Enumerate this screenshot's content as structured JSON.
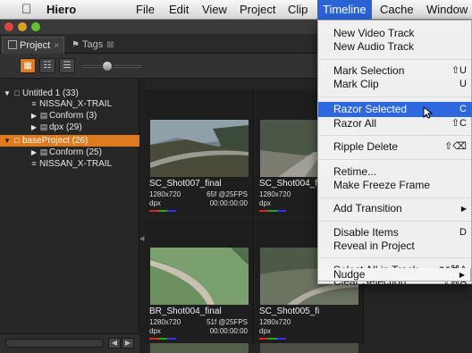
{
  "menubar": {
    "app_name": "Hiero",
    "items": [
      "File",
      "Edit",
      "View",
      "Project",
      "Clip",
      "Timeline",
      "Cache",
      "Window"
    ],
    "active_item": "Timeline"
  },
  "tabs": [
    {
      "label": "Project",
      "close": "×"
    },
    {
      "label": "Tags",
      "close": "⊠"
    }
  ],
  "tree": [
    {
      "label": "Untitled 1 (33)",
      "icon": "project-icon",
      "expanded": true
    },
    {
      "label": "NISSAN_X-TRAIL",
      "icon": "sequence-icon"
    },
    {
      "label": "Conform (3)",
      "icon": "bin-icon",
      "expanded": false
    },
    {
      "label": "dpx (29)",
      "icon": "bin-icon",
      "expanded": false
    },
    {
      "label": "baseProject (26)",
      "icon": "project-icon",
      "expanded": true,
      "selected": true
    },
    {
      "label": "Conform (25)",
      "icon": "bin-icon",
      "expanded": false
    },
    {
      "label": "NISSAN_X-TRAIL",
      "icon": "sequence-icon"
    }
  ],
  "clips": [
    {
      "name": "SC_Shot007_final",
      "res": "1280x720",
      "fps": "65f @25FPS",
      "tc": "00:00:00:00",
      "fmt": "dpx"
    },
    {
      "name": "SC_Shot004_fi",
      "res": "1280x720",
      "fps": "",
      "tc": "",
      "fmt": "dpx"
    },
    {
      "name": "BR_Shot004_final",
      "res": "1280x720",
      "fps": "51f @25FPS",
      "tc": "00:00:00:00",
      "fmt": "dpx"
    },
    {
      "name": "SC_Shot005_fi",
      "res": "1280x720",
      "fps": "",
      "tc": "",
      "fmt": "dpx"
    }
  ],
  "menu": {
    "items": [
      {
        "label": "New Video Track",
        "shortcut": ""
      },
      {
        "label": "New Audio Track",
        "shortcut": ""
      },
      {
        "label": "Mark Selection",
        "shortcut": "⇧U"
      },
      {
        "label": "Mark Clip",
        "shortcut": "U"
      },
      {
        "label": "Razor Selected",
        "shortcut": "C",
        "highlighted": true
      },
      {
        "label": "Razor All",
        "shortcut": "⇧C"
      },
      {
        "label": "Ripple Delete",
        "shortcut": "⇧⌫"
      },
      {
        "label": "Retime...",
        "shortcut": ""
      },
      {
        "label": "Make Freeze Frame",
        "shortcut": ""
      },
      {
        "label": "Add Transition",
        "shortcut": "",
        "submenu": true
      },
      {
        "label": "Disable Items",
        "shortcut": "D"
      },
      {
        "label": "Reveal in Project",
        "shortcut": ""
      },
      {
        "label": "Select All in Track",
        "shortcut": "⌥⌘A"
      },
      {
        "label": "Clear Selection",
        "shortcut": "⇧⌘A"
      },
      {
        "label": "Nudge",
        "shortcut": "",
        "submenu": true
      }
    ]
  },
  "colors": {
    "accent": "#e07a1f",
    "menu_highlight": "#2d68de"
  }
}
